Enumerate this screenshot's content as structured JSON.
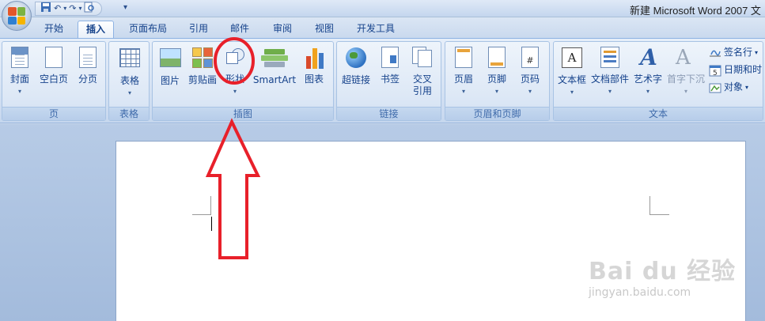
{
  "window": {
    "title": "新建 Microsoft Word 2007 文"
  },
  "qat": {
    "save_icon": "save-icon",
    "undo_icon": "undo-icon",
    "redo_icon": "redo-icon",
    "preview_icon": "print-preview-icon"
  },
  "tabs": [
    {
      "label": "开始"
    },
    {
      "label": "插入"
    },
    {
      "label": "页面布局"
    },
    {
      "label": "引用"
    },
    {
      "label": "邮件"
    },
    {
      "label": "审阅"
    },
    {
      "label": "视图"
    },
    {
      "label": "开发工具"
    }
  ],
  "active_tab": "插入",
  "groups": {
    "pages": {
      "label": "页",
      "buttons": [
        "封面",
        "空白页",
        "分页"
      ]
    },
    "tables": {
      "label": "表格",
      "buttons": [
        "表格"
      ]
    },
    "illustrations": {
      "label": "插图",
      "buttons": [
        "图片",
        "剪贴画",
        "形状",
        "SmartArt",
        "图表"
      ]
    },
    "links": {
      "label": "链接",
      "buttons": [
        "超链接",
        "书签",
        "交叉",
        "引用"
      ]
    },
    "header_footer": {
      "label": "页眉和页脚",
      "buttons": [
        "页眉",
        "页脚",
        "页码"
      ]
    },
    "text": {
      "label": "文本",
      "buttons": [
        "文本框",
        "文档部件",
        "艺术字",
        "首字下沉"
      ],
      "small": [
        "签名行",
        "日期和时",
        "对象"
      ]
    }
  },
  "watermark": {
    "brand": "Bai du 经验",
    "url": "jingyan.baidu.com"
  },
  "colors": {
    "annotation": "#e8202a",
    "ribbon_bg": "#dde8f6",
    "doc_bg": "#a3bbdc"
  }
}
